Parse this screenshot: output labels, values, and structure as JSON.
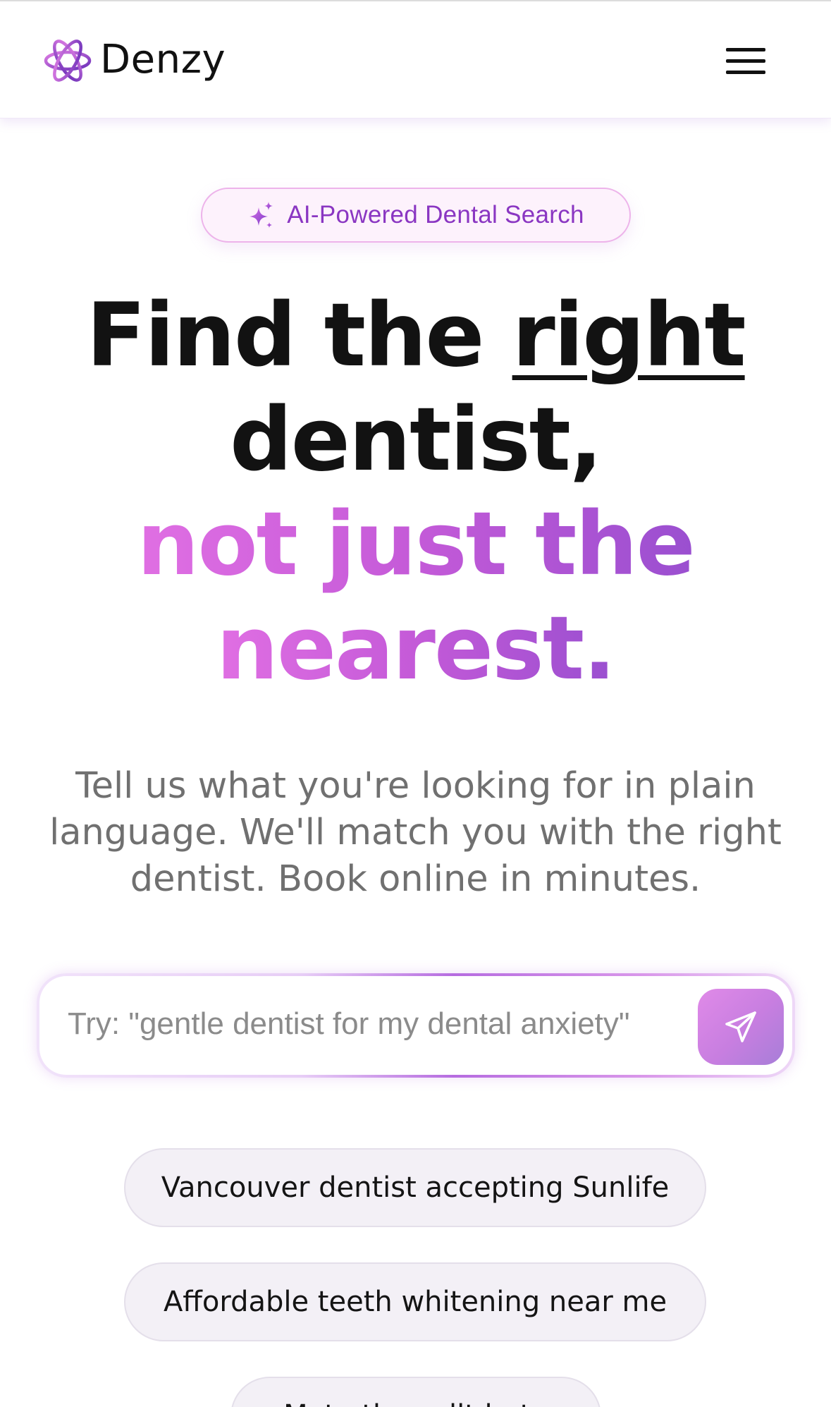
{
  "header": {
    "brand_name": "Denzy",
    "logo_icon": "atom-logo-icon",
    "menu_icon": "hamburger-menu-icon"
  },
  "hero": {
    "badge": {
      "icon": "sparkle-icon",
      "label": "AI-Powered Dental Search"
    },
    "headline": {
      "line1_prefix": "Find the ",
      "line1_emphasis": "right",
      "line2": "dentist,",
      "line3": "not just the",
      "line4": "nearest."
    },
    "subtitle": "Tell us what you're looking for in plain language. We'll match you with the right dentist. Book online in minutes."
  },
  "search": {
    "placeholder": "Try: \"gentle dentist for my dental anxiety\"",
    "value": "",
    "send_icon": "send-paper-plane-icon"
  },
  "suggestions": [
    {
      "label": "Vancouver dentist accepting Sunlife"
    },
    {
      "label": "Affordable teeth whitening near me"
    },
    {
      "label": "Myte thes allt beta"
    }
  ],
  "colors": {
    "accent_purple": "#8a36c2",
    "gradient_start": "#e06fe3",
    "gradient_end": "#9a4fd0",
    "chip_background": "#f3f0f6",
    "text_dark": "#121212",
    "text_muted": "#707070"
  }
}
